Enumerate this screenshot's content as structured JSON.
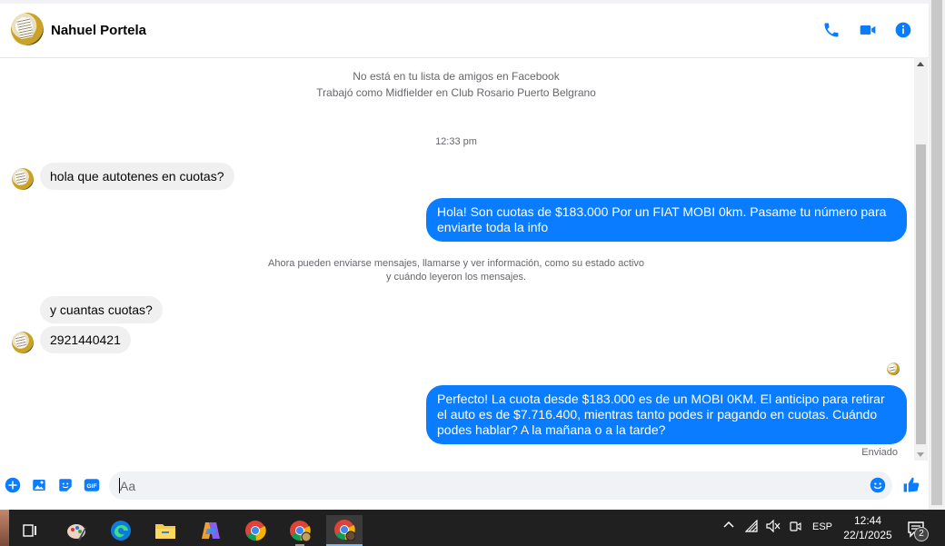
{
  "header": {
    "contact_name": "Nahuel Portela",
    "icons": [
      "phone-icon",
      "video-camera-icon",
      "info-icon"
    ]
  },
  "thread": {
    "info_line_1": "No está en tu lista de amigos en Facebook",
    "info_line_2": "Trabajó como Midfielder en Club Rosario Puerto Belgrano",
    "timestamp": "12:33 pm",
    "system_line_1": "Ahora pueden enviarse mensajes, llamarse y ver información, como su estado activo",
    "system_line_2": "y cuándo leyeron los mensajes.",
    "messages": [
      {
        "direction": "in",
        "text": "hola que autotenes  en cuotas?"
      },
      {
        "direction": "out",
        "text": "Hola! Son cuotas de $183.000 Por un FIAT MOBI 0km. Pasame tu número para enviarte toda la info"
      },
      {
        "direction": "in",
        "text": "y cuantas cuotas?"
      },
      {
        "direction": "in",
        "text": "2921440421"
      },
      {
        "direction": "out",
        "text": "Perfecto! La cuota desde $183.000 es de un MOBI 0KM. El anticipo para retirar el auto es de $7.716.400, mientras tanto podes ir pagando en cuotas. Cuándo podes hablar? A la mañana o a la tarde?"
      }
    ],
    "sent_status": "Enviado"
  },
  "composer": {
    "placeholder": "Aa",
    "gif_label": "GIF",
    "icons": [
      "plus-circle-icon",
      "photo-icon",
      "sticker-icon",
      "gif-icon",
      "emoji-icon",
      "thumbs-up-icon"
    ]
  },
  "taskbar": {
    "apps": [
      "task-view-icon",
      "paint-icon",
      "edge-icon",
      "file-explorer-icon",
      "copilot-icon",
      "chrome-icon",
      "chrome-profile-icon",
      "chrome-active-icon"
    ],
    "language": "ESP",
    "time": "12:44",
    "date": "22/1/2025",
    "notification_count": "2"
  }
}
